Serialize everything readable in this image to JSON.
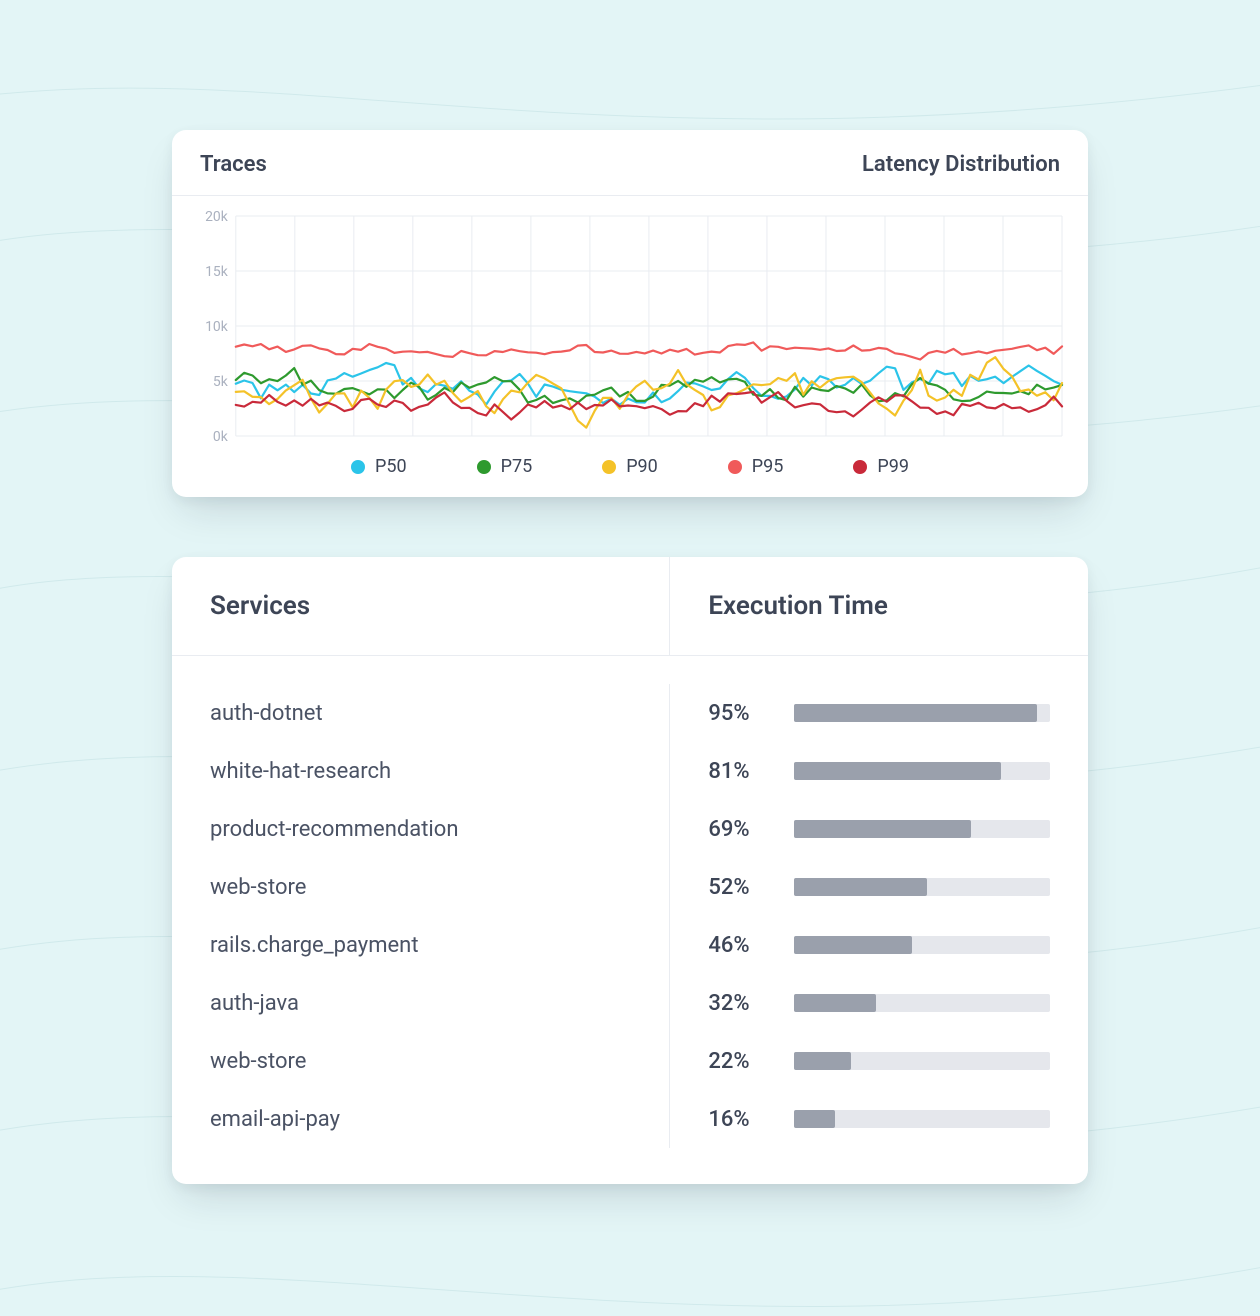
{
  "chart": {
    "title_left": "Traces",
    "title_right": "Latency Distribution",
    "yticks": [
      "20k",
      "15k",
      "10k",
      "5k",
      "0k"
    ],
    "legend": [
      {
        "label": "P50",
        "color": "#2bc4e9"
      },
      {
        "label": "P75",
        "color": "#2e9a2e"
      },
      {
        "label": "P90",
        "color": "#f4c228"
      },
      {
        "label": "P95",
        "color": "#f05a5a"
      },
      {
        "label": "P99",
        "color": "#c92a3a"
      }
    ]
  },
  "services": {
    "head_left": "Services",
    "head_right": "Execution Time",
    "rows": [
      {
        "name": "auth-dotnet",
        "pct": 95
      },
      {
        "name": "white-hat-research",
        "pct": 81
      },
      {
        "name": "product-recommendation",
        "pct": 69
      },
      {
        "name": "web-store",
        "pct": 52
      },
      {
        "name": "rails.charge_payment",
        "pct": 46
      },
      {
        "name": "auth-java",
        "pct": 32
      },
      {
        "name": "web-store",
        "pct": 22
      },
      {
        "name": "email-api-pay",
        "pct": 16
      }
    ]
  },
  "chart_data": {
    "type": "line",
    "title": "Latency Distribution",
    "ylabel": "Traces",
    "ylim": [
      0,
      20000
    ],
    "yticks": [
      0,
      5000,
      10000,
      15000,
      20000
    ],
    "x_points": 100,
    "series": [
      {
        "name": "P50",
        "color": "#2bc4e9",
        "approx_range": [
          1500,
          7500
        ],
        "approx_mean": 4500
      },
      {
        "name": "P75",
        "color": "#2e9a2e",
        "approx_range": [
          2000,
          7000
        ],
        "approx_mean": 4200
      },
      {
        "name": "P90",
        "color": "#f4c228",
        "approx_range": [
          1000,
          9500
        ],
        "approx_mean": 4000
      },
      {
        "name": "P95",
        "color": "#f05a5a",
        "approx_range": [
          6500,
          8800
        ],
        "approx_mean": 7800
      },
      {
        "name": "P99",
        "color": "#c92a3a",
        "approx_range": [
          1200,
          5500
        ],
        "approx_mean": 3000
      }
    ],
    "note": "Exact per-point values are not labeled in the source image; series are characterized by approximate range and mean read from the y-axis gridlines."
  }
}
